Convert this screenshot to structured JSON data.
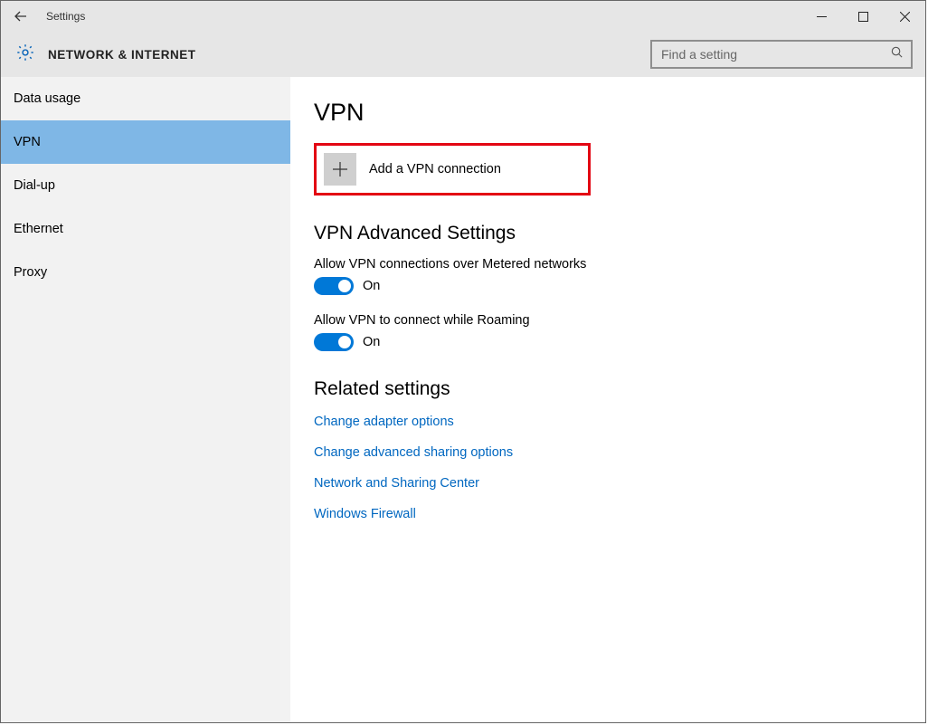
{
  "window": {
    "title": "Settings"
  },
  "header": {
    "section_title": "NETWORK & INTERNET",
    "search_placeholder": "Find a setting"
  },
  "sidebar": {
    "items": [
      {
        "label": "Data usage",
        "selected": false
      },
      {
        "label": "VPN",
        "selected": true
      },
      {
        "label": "Dial-up",
        "selected": false
      },
      {
        "label": "Ethernet",
        "selected": false
      },
      {
        "label": "Proxy",
        "selected": false
      }
    ]
  },
  "main": {
    "heading": "VPN",
    "add_label": "Add a VPN connection",
    "advanced_heading": "VPN Advanced Settings",
    "settings": [
      {
        "label": "Allow VPN connections over Metered networks",
        "state": "On"
      },
      {
        "label": "Allow VPN to connect while Roaming",
        "state": "On"
      }
    ],
    "related_heading": "Related settings",
    "links": [
      "Change adapter options",
      "Change advanced sharing options",
      "Network and Sharing Center",
      "Windows Firewall"
    ]
  },
  "colors": {
    "accent": "#0078d7",
    "highlight_red": "#e30613",
    "sidebar_selected": "#7fb7e6"
  }
}
